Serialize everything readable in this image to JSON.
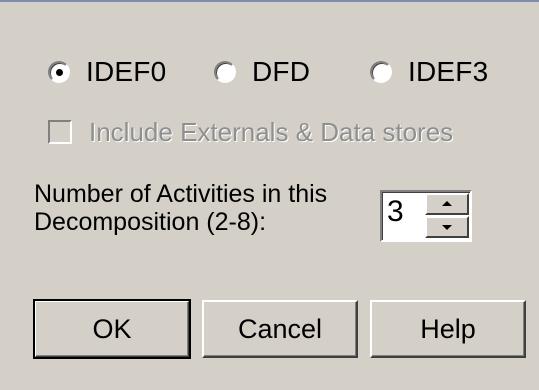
{
  "dialog": {
    "diagram_types": [
      {
        "label": "IDEF0",
        "selected": true
      },
      {
        "label": "DFD",
        "selected": false
      },
      {
        "label": "IDEF3",
        "selected": false
      }
    ],
    "include_externals": {
      "label": "Include Externals & Data stores",
      "checked": false,
      "enabled": false
    },
    "activities": {
      "label_line1": "Number of Activities in this",
      "label_line2": "Decomposition (2-8):",
      "value": "3"
    },
    "buttons": {
      "ok_label": "OK",
      "cancel_label": "Cancel",
      "help_label": "Help"
    }
  }
}
